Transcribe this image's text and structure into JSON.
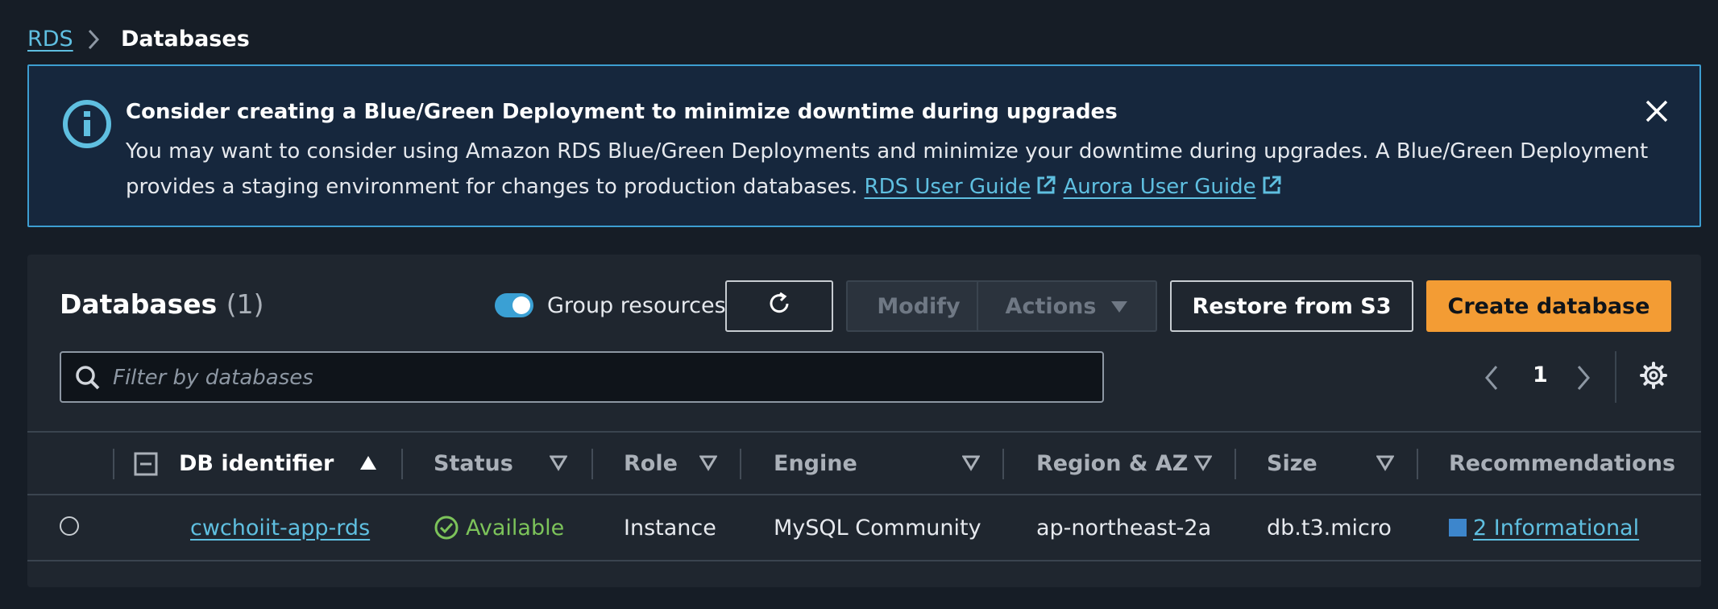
{
  "breadcrumb": {
    "parent": "RDS",
    "current": "Databases"
  },
  "banner": {
    "title": "Consider creating a Blue/Green Deployment to minimize downtime during upgrades",
    "body_line1": "You may want to consider using Amazon RDS Blue/Green Deployments and minimize your downtime during upgrades. A Blue/Green Deployment",
    "body_line2": "provides a staging environment for changes to production databases.",
    "link_rds": "RDS User Guide",
    "link_aurora": "Aurora User Guide",
    "accent_color": "#3d9ed1"
  },
  "panel": {
    "title": "Databases",
    "count": "(1)",
    "group_resources_label": "Group resources",
    "group_resources_on": true,
    "buttons": {
      "modify": "Modify",
      "actions": "Actions",
      "restore": "Restore from S3",
      "create": "Create database"
    },
    "search_placeholder": "Filter by databases",
    "page_number": "1",
    "primary_color": "#f39c34"
  },
  "table": {
    "columns": {
      "db_identifier": "DB identifier",
      "status": "Status",
      "role": "Role",
      "engine": "Engine",
      "region": "Region & AZ",
      "size": "Size",
      "recommendations": "Recommendations"
    },
    "rows": [
      {
        "db_identifier": "cwchoiit-app-rds",
        "status": "Available",
        "role": "Instance",
        "engine": "MySQL Community",
        "region": "ap-northeast-2a",
        "size": "db.t3.micro",
        "recommendations": "2 Informational"
      }
    ]
  }
}
